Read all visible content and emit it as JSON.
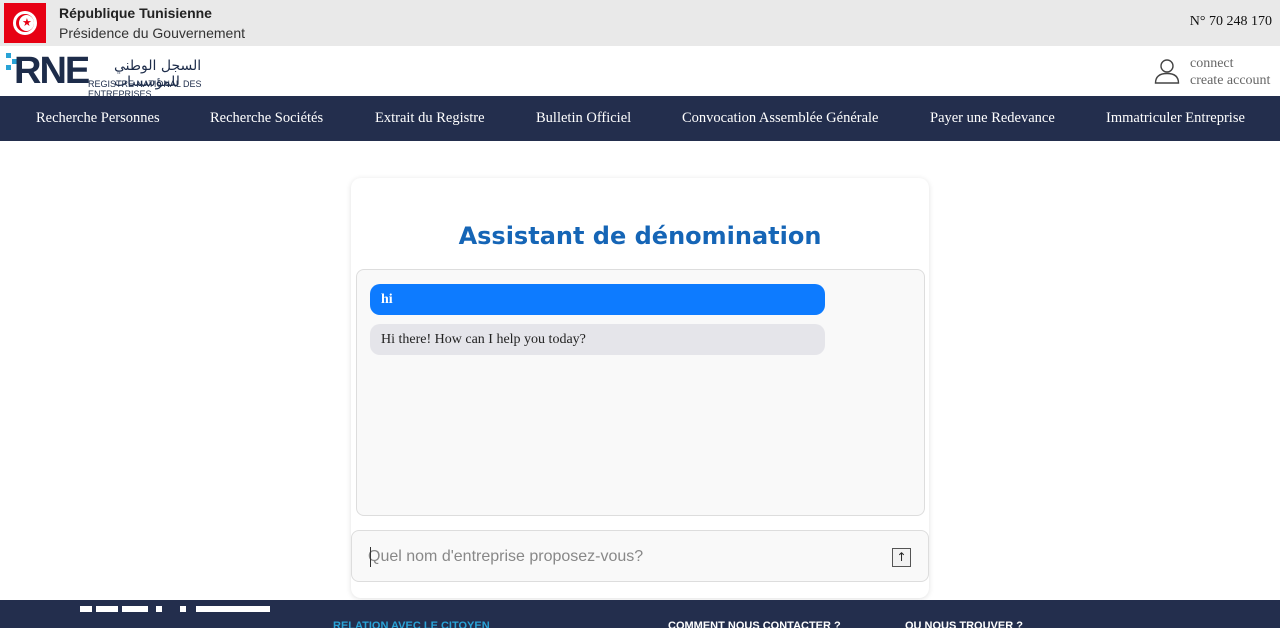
{
  "gov": {
    "title": "République Tunisienne",
    "subtitle": "Présidence du Gouvernement",
    "phone": "N° 70 248 170"
  },
  "logo": {
    "abbr": "RNE",
    "arabic": "السجل الوطني للمؤسسات",
    "french": "REGISTRE NATIONAL DES ENTREPRISES"
  },
  "account": {
    "connect": "connect",
    "create": "create account"
  },
  "nav": [
    {
      "label": "Recherche Personnes"
    },
    {
      "label": "Recherche Sociétés"
    },
    {
      "label": "Extrait du Registre"
    },
    {
      "label": "Bulletin Officiel"
    },
    {
      "label": "Convocation Assemblée Générale"
    },
    {
      "label": "Payer une Redevance"
    },
    {
      "label": "Immatriculer Entreprise"
    }
  ],
  "chat": {
    "title": "Assistant de dénomination",
    "messages": [
      {
        "from": "user",
        "text": "hi"
      },
      {
        "from": "bot",
        "text": "Hi there! How can I help you today?"
      }
    ],
    "input_placeholder": "Quel nom d'entreprise proposez-vous?",
    "input_value": "",
    "send_icon": "↑"
  },
  "footer": {
    "col1": "RELATION AVEC LE CITOYEN",
    "col2": "COMMENT NOUS CONTACTER ?",
    "col3": "OU NOUS TROUVER ?"
  },
  "colors": {
    "navbar": "#232e4d",
    "accent_title": "#1565b6",
    "user_bubble": "#0d7bff",
    "bot_bubble": "#e5e5ea",
    "footer_link_primary": "#29a3d6"
  },
  "icons": {
    "flag": "tunisia-flag-icon",
    "user": "user-icon",
    "send": "arrow-up-icon"
  }
}
